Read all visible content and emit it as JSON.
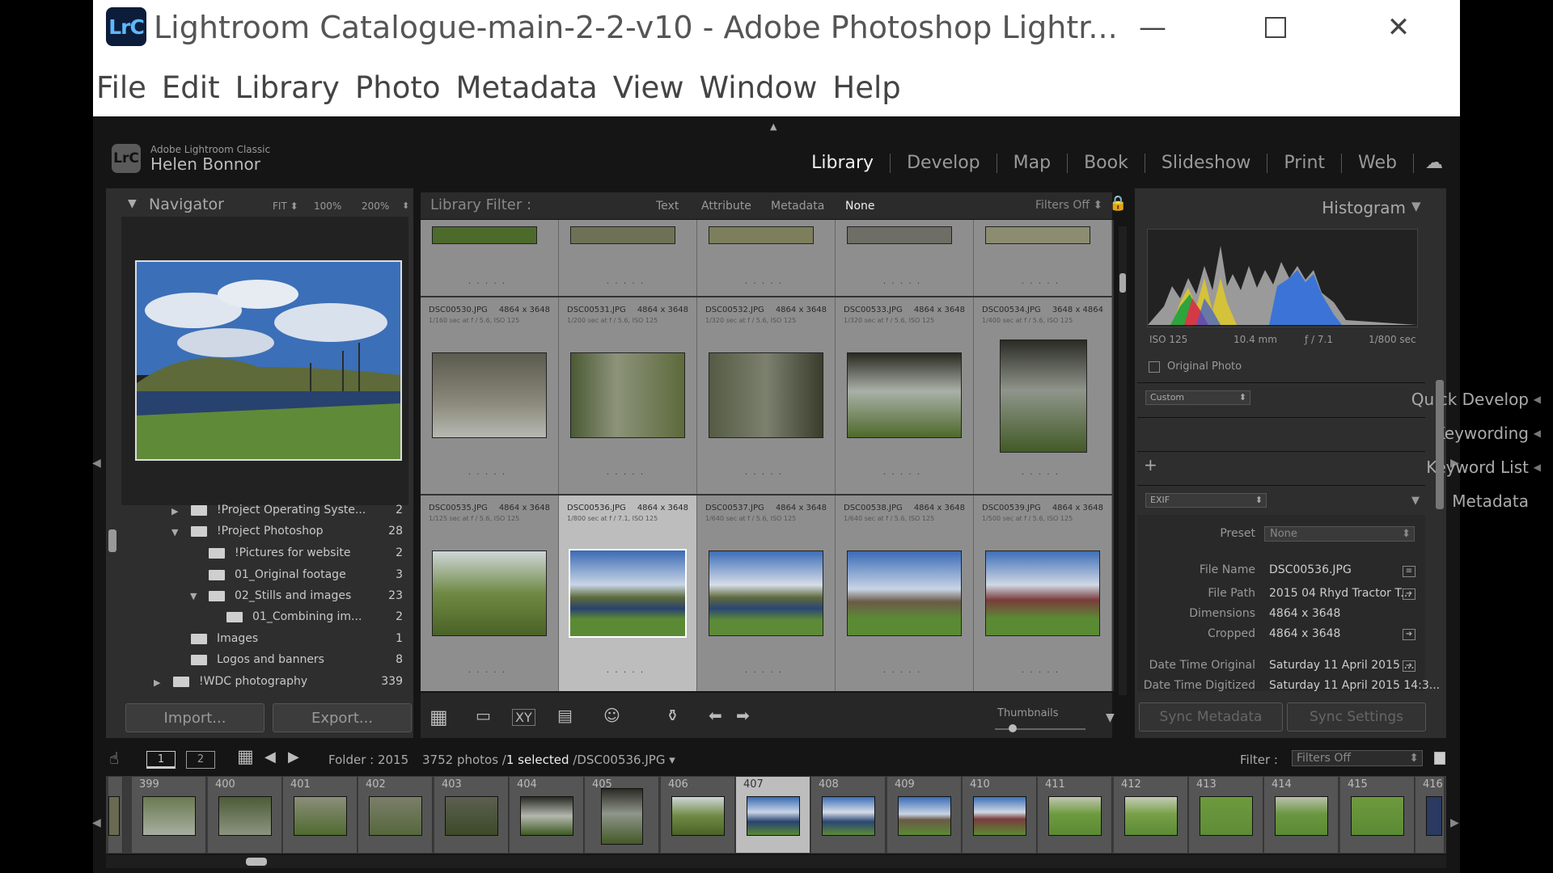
{
  "window": {
    "title": "Lightroom Catalogue-main-2-2-v10 - Adobe Photoshop Lightr...",
    "logo_text": "LrC"
  },
  "menu": [
    "File",
    "Edit",
    "Library",
    "Photo",
    "Metadata",
    "View",
    "Window",
    "Help"
  ],
  "identity": {
    "badge": "LrC",
    "product": "Adobe Lightroom Classic",
    "user": "Helen Bonnor"
  },
  "modules": [
    "Library",
    "Develop",
    "Map",
    "Book",
    "Slideshow",
    "Print",
    "Web"
  ],
  "active_module": "Library",
  "navigator": {
    "title": "Navigator",
    "fit": "FIT",
    "z100": "100%",
    "z200": "200%"
  },
  "folders": [
    {
      "name": "!Project Operating Syste...",
      "count": "2"
    },
    {
      "name": "!Project Photoshop",
      "count": "28"
    },
    {
      "name": "!Pictures for website",
      "count": "2"
    },
    {
      "name": "01_Original footage",
      "count": "3"
    },
    {
      "name": "02_Stills and images",
      "count": "23"
    },
    {
      "name": "01_Combining im...",
      "count": "2"
    },
    {
      "name": "Images",
      "count": "1"
    },
    {
      "name": "Logos and banners",
      "count": "8"
    },
    {
      "name": "!WDC photography",
      "count": "339"
    }
  ],
  "left_buttons": {
    "import": "Import...",
    "export": "Export..."
  },
  "library_filter": {
    "label": "Library Filter :",
    "options": [
      "Text",
      "Attribute",
      "Metadata",
      "None"
    ],
    "active": "None",
    "filters_state": "Filters Off"
  },
  "grid": {
    "row2": [
      {
        "file": "DSC00530.JPG",
        "dims": "4864 x 3648",
        "exif": "1/160 sec at f / 5.6, ISO 125"
      },
      {
        "file": "DSC00531.JPG",
        "dims": "4864 x 3648",
        "exif": "1/200 sec at f / 5.6, ISO 125"
      },
      {
        "file": "DSC00532.JPG",
        "dims": "4864 x 3648",
        "exif": "1/320 sec at f / 5.6, ISO 125"
      },
      {
        "file": "DSC00533.JPG",
        "dims": "4864 x 3648",
        "exif": "1/320 sec at f / 5.6, ISO 125"
      },
      {
        "file": "DSC00534.JPG",
        "dims": "3648 x 4864",
        "exif": "1/400 sec at f / 5.6, ISO 125"
      }
    ],
    "row3": [
      {
        "file": "DSC00535.JPG",
        "dims": "4864 x 3648",
        "exif": "1/125 sec at f / 5.6, ISO 125"
      },
      {
        "file": "DSC00536.JPG",
        "dims": "4864 x 3648",
        "exif": "1/800 sec at f / 7.1, ISO 125"
      },
      {
        "file": "DSC00537.JPG",
        "dims": "4864 x 3648",
        "exif": "1/640 sec at f / 5.6, ISO 125"
      },
      {
        "file": "DSC00538.JPG",
        "dims": "4864 x 3648",
        "exif": "1/640 sec at f / 5.6, ISO 125"
      },
      {
        "file": "DSC00539.JPG",
        "dims": "4864 x 3648",
        "exif": "1/500 sec at f / 5.6, ISO 125"
      }
    ]
  },
  "toolbar": {
    "thumbnails_label": "Thumbnails",
    "thumbnail_size": 0.2
  },
  "histogram": {
    "title": "Histogram",
    "iso": "ISO 125",
    "focal": "10.4 mm",
    "aperture": "ƒ / 7.1",
    "shutter": "1/800 sec",
    "original_photo": "Original Photo"
  },
  "quick_develop": {
    "title": "Quick Develop",
    "preset": "Custom"
  },
  "keywording": {
    "title": "Keywording"
  },
  "keyword_list": {
    "title": "Keyword List"
  },
  "metadata": {
    "title": "Metadata",
    "view": "EXIF",
    "preset_label": "Preset",
    "preset_value": "None",
    "fields": [
      {
        "label": "File Name",
        "value": "DSC00536.JPG"
      },
      {
        "label": "File Path",
        "value": "2015 04 Rhyd Tractor T..."
      },
      {
        "label": "Dimensions",
        "value": "4864 x 3648"
      },
      {
        "label": "Cropped",
        "value": "4864 x 3648"
      },
      {
        "label": "Date Time Original",
        "value": "Saturday 11 April 2015 ..."
      },
      {
        "label": "Date Time Digitized",
        "value": "Saturday 11 April 2015 14:3..."
      }
    ]
  },
  "sync": {
    "metadata": "Sync Metadata",
    "settings": "Sync Settings"
  },
  "filmstrip_bar": {
    "screen1": "1",
    "screen2": "2",
    "source": "Folder : 2015",
    "count": "3752 photos /",
    "selected": "1 selected",
    "current": "/DSC00536.JPG",
    "filter_label": "Filter :",
    "filter_value": "Filters Off"
  },
  "filmstrip": [
    "399",
    "400",
    "401",
    "402",
    "403",
    "404",
    "405",
    "406",
    "407",
    "408",
    "409",
    "410",
    "411",
    "412",
    "413",
    "414",
    "415",
    "416"
  ],
  "filmstrip_selected": "407",
  "colors": {
    "accent_selected": "#bdbdbd",
    "panel": "#2e2e2e",
    "grid_cell": "#8e8e8e"
  }
}
